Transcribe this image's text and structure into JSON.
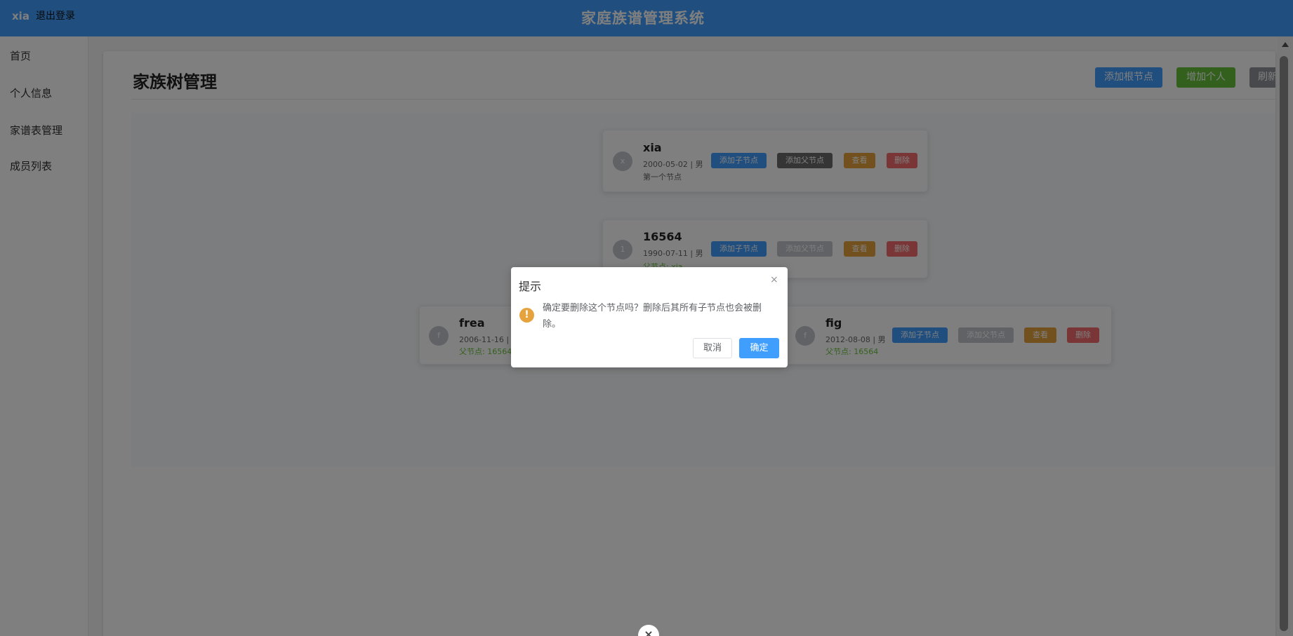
{
  "header": {
    "user": "xia",
    "logout_label": "退出登录",
    "title": "家庭族谱管理系统"
  },
  "sidebar": {
    "items": [
      {
        "label": "首页"
      },
      {
        "label": "个人信息"
      },
      {
        "label": "家谱表管理"
      },
      {
        "label": "成员列表"
      }
    ]
  },
  "page": {
    "title": "家族树管理",
    "buttons": {
      "add_root": "添加根节点",
      "add_person": "增加个人",
      "refresh": "刷新"
    }
  },
  "tree": {
    "nodes": [
      {
        "initial": "x",
        "name": "xia",
        "meta": "2000-05-02 | 男",
        "note": "第一个节点",
        "parent": ""
      },
      {
        "initial": "1",
        "name": "16564",
        "meta": "1990-07-11 | 男",
        "note": "",
        "parent": "父节点: xia"
      },
      {
        "initial": "f",
        "name": "frea",
        "meta": "2006-11-16 | 男",
        "note": "",
        "parent": "父节点: 16564"
      },
      {
        "initial": "f",
        "name": "fig",
        "meta": "2012-08-08 | 男",
        "note": "",
        "parent": "父节点: 16564"
      }
    ],
    "actions": {
      "add_child": "添加子节点",
      "add_parent": "添加父节点",
      "view": "查看",
      "delete": "删除"
    }
  },
  "dialog": {
    "title": "提示",
    "close_icon": "×",
    "warning_icon": "!",
    "message": "确定要删除这个节点吗？删除后其所有子节点也会被删除。",
    "cancel_label": "取消",
    "confirm_label": "确定"
  },
  "bottom_close_icon": "×",
  "colors": {
    "primary": "#409eff",
    "success": "#67c23a",
    "warning": "#e6a23c",
    "danger": "#f56c6c",
    "info": "#909399"
  }
}
